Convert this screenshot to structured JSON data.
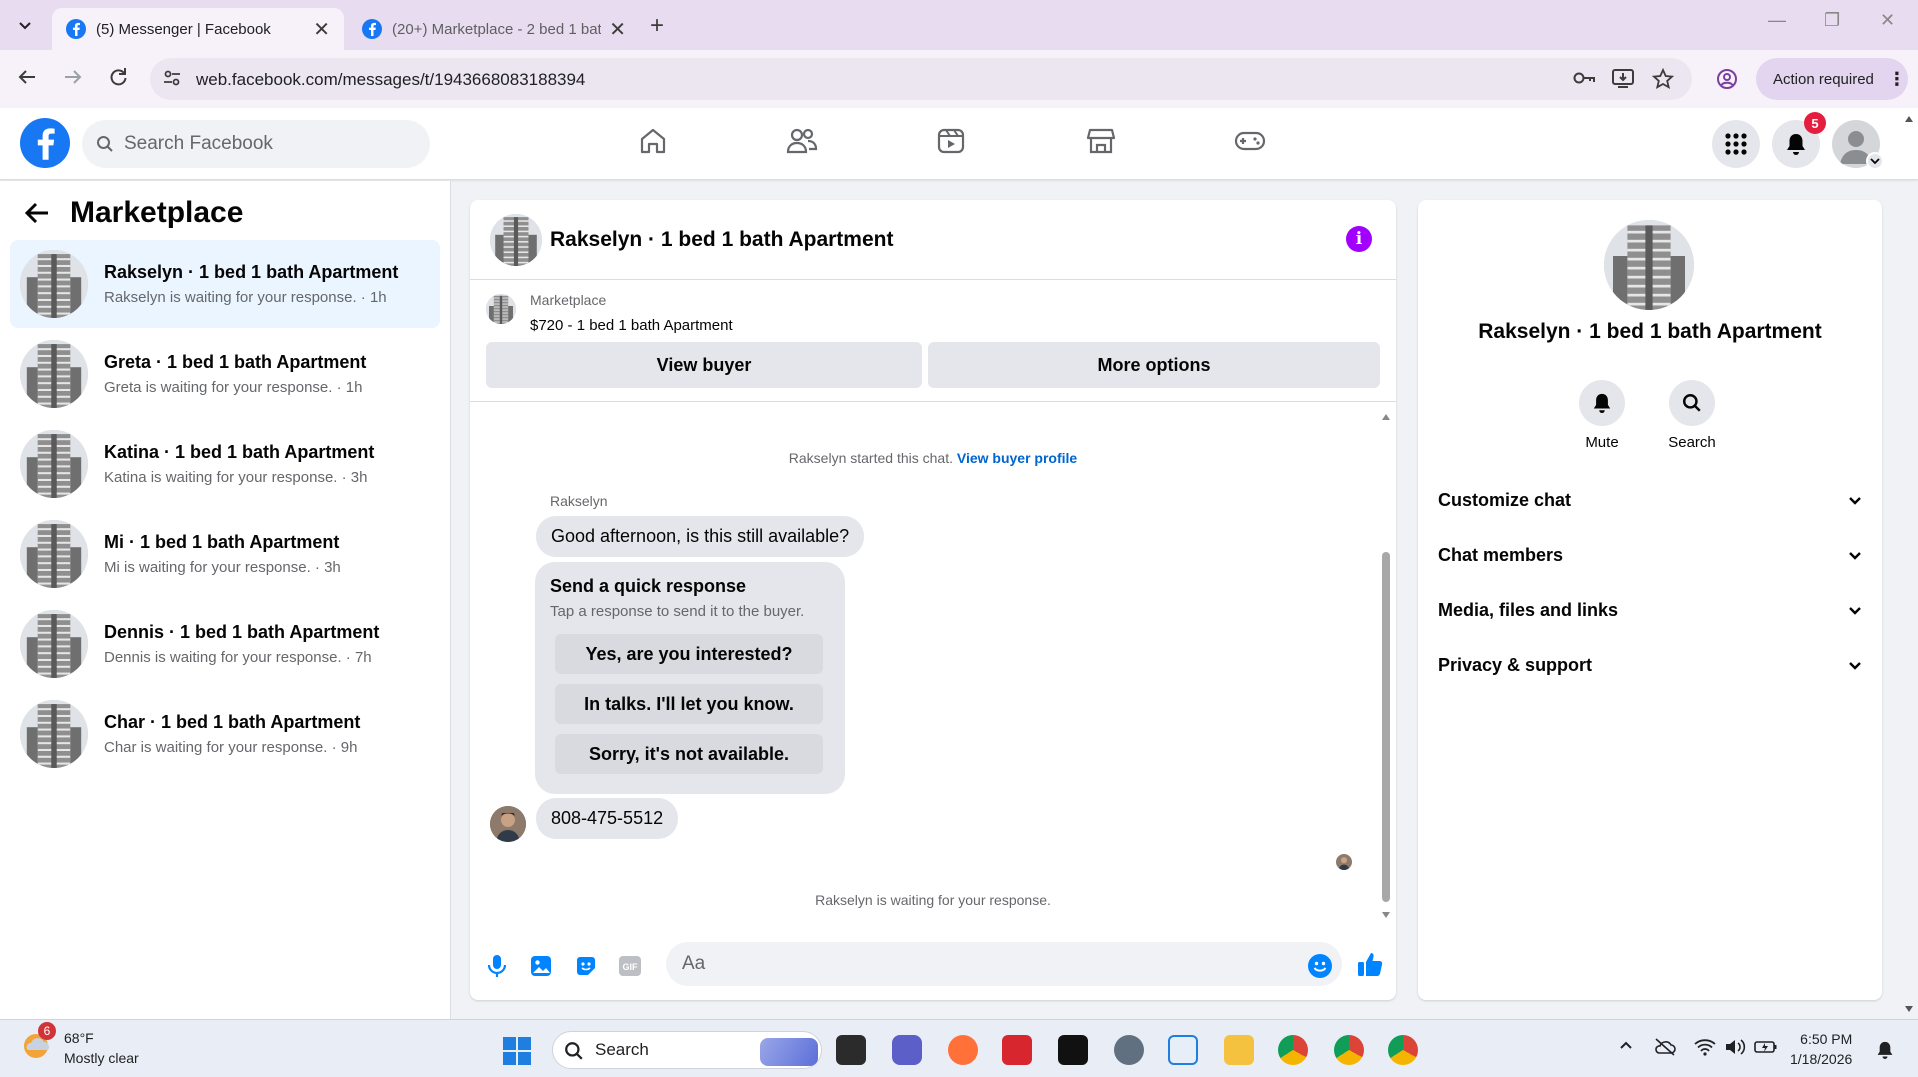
{
  "browser": {
    "tabs": [
      {
        "title": "(5) Messenger | Facebook",
        "active": true
      },
      {
        "title": "(20+) Marketplace - 2 bed 1 bath",
        "active": false
      }
    ],
    "url": "web.facebook.com/messages/t/1943668083188394",
    "action_required": "Action required"
  },
  "fb": {
    "search_placeholder": "Search Facebook",
    "notification_count": "5",
    "nav_icons": [
      "home-icon",
      "friends-icon",
      "watch-icon",
      "marketplace-icon",
      "gaming-icon"
    ]
  },
  "sidebar": {
    "title": "Marketplace",
    "conversations": [
      {
        "name": "Rakselyn · 1 bed 1 bath Apartment",
        "sub": "Rakselyn is waiting for your response. · 1h",
        "selected": true
      },
      {
        "name": "Greta · 1 bed 1 bath Apartment",
        "sub": "Greta is waiting for your response. · 1h"
      },
      {
        "name": "Katina · 1 bed 1 bath Apartment",
        "sub": "Katina is waiting for your response. · 3h"
      },
      {
        "name": "Mi · 1 bed 1 bath Apartment",
        "sub": "Mi is waiting for your response. · 3h"
      },
      {
        "name": "Dennis · 1 bed 1 bath Apartment",
        "sub": "Dennis is waiting for your response. · 7h"
      },
      {
        "name": "Char · 1 bed 1 bath Apartment",
        "sub": "Char is waiting for your response. · 9h"
      }
    ]
  },
  "chat": {
    "title": "Rakselyn · 1 bed 1 bath Apartment",
    "listing_label": "Marketplace",
    "listing_price": "$720 - 1 bed 1 bath Apartment",
    "view_buyer": "View buyer",
    "more_options": "More options",
    "started_text": "Rakselyn started this chat.",
    "view_buyer_profile": "View buyer profile",
    "sender": "Rakselyn",
    "message1": "Good afternoon, is this still available?",
    "quick_response": {
      "title": "Send a quick response",
      "subtitle": "Tap a response to send it to the buyer.",
      "options": [
        "Yes, are you interested?",
        "In talks. I'll let you know.",
        "Sorry, it's not available."
      ]
    },
    "message2": "808-475-5512",
    "waiting": "Rakselyn is waiting for your response.",
    "composer_placeholder": "Aa"
  },
  "info_panel": {
    "title": "Rakselyn · 1 bed 1 bath Apartment",
    "actions": [
      "Mute",
      "Search"
    ],
    "sections": [
      "Customize chat",
      "Chat members",
      "Media, files and links",
      "Privacy & support"
    ]
  },
  "taskbar": {
    "weather_badge": "6",
    "temp": "68°F",
    "condition": "Mostly clear",
    "search": "Search",
    "time": "6:50 PM",
    "date": "1/18/2026"
  },
  "colors": {
    "fb_blue": "#1877f2",
    "selected_bg": "#ebf5ff",
    "bubble_gray": "#e4e6eb",
    "link_blue": "#0064d1",
    "info_purple": "#a100ff"
  }
}
